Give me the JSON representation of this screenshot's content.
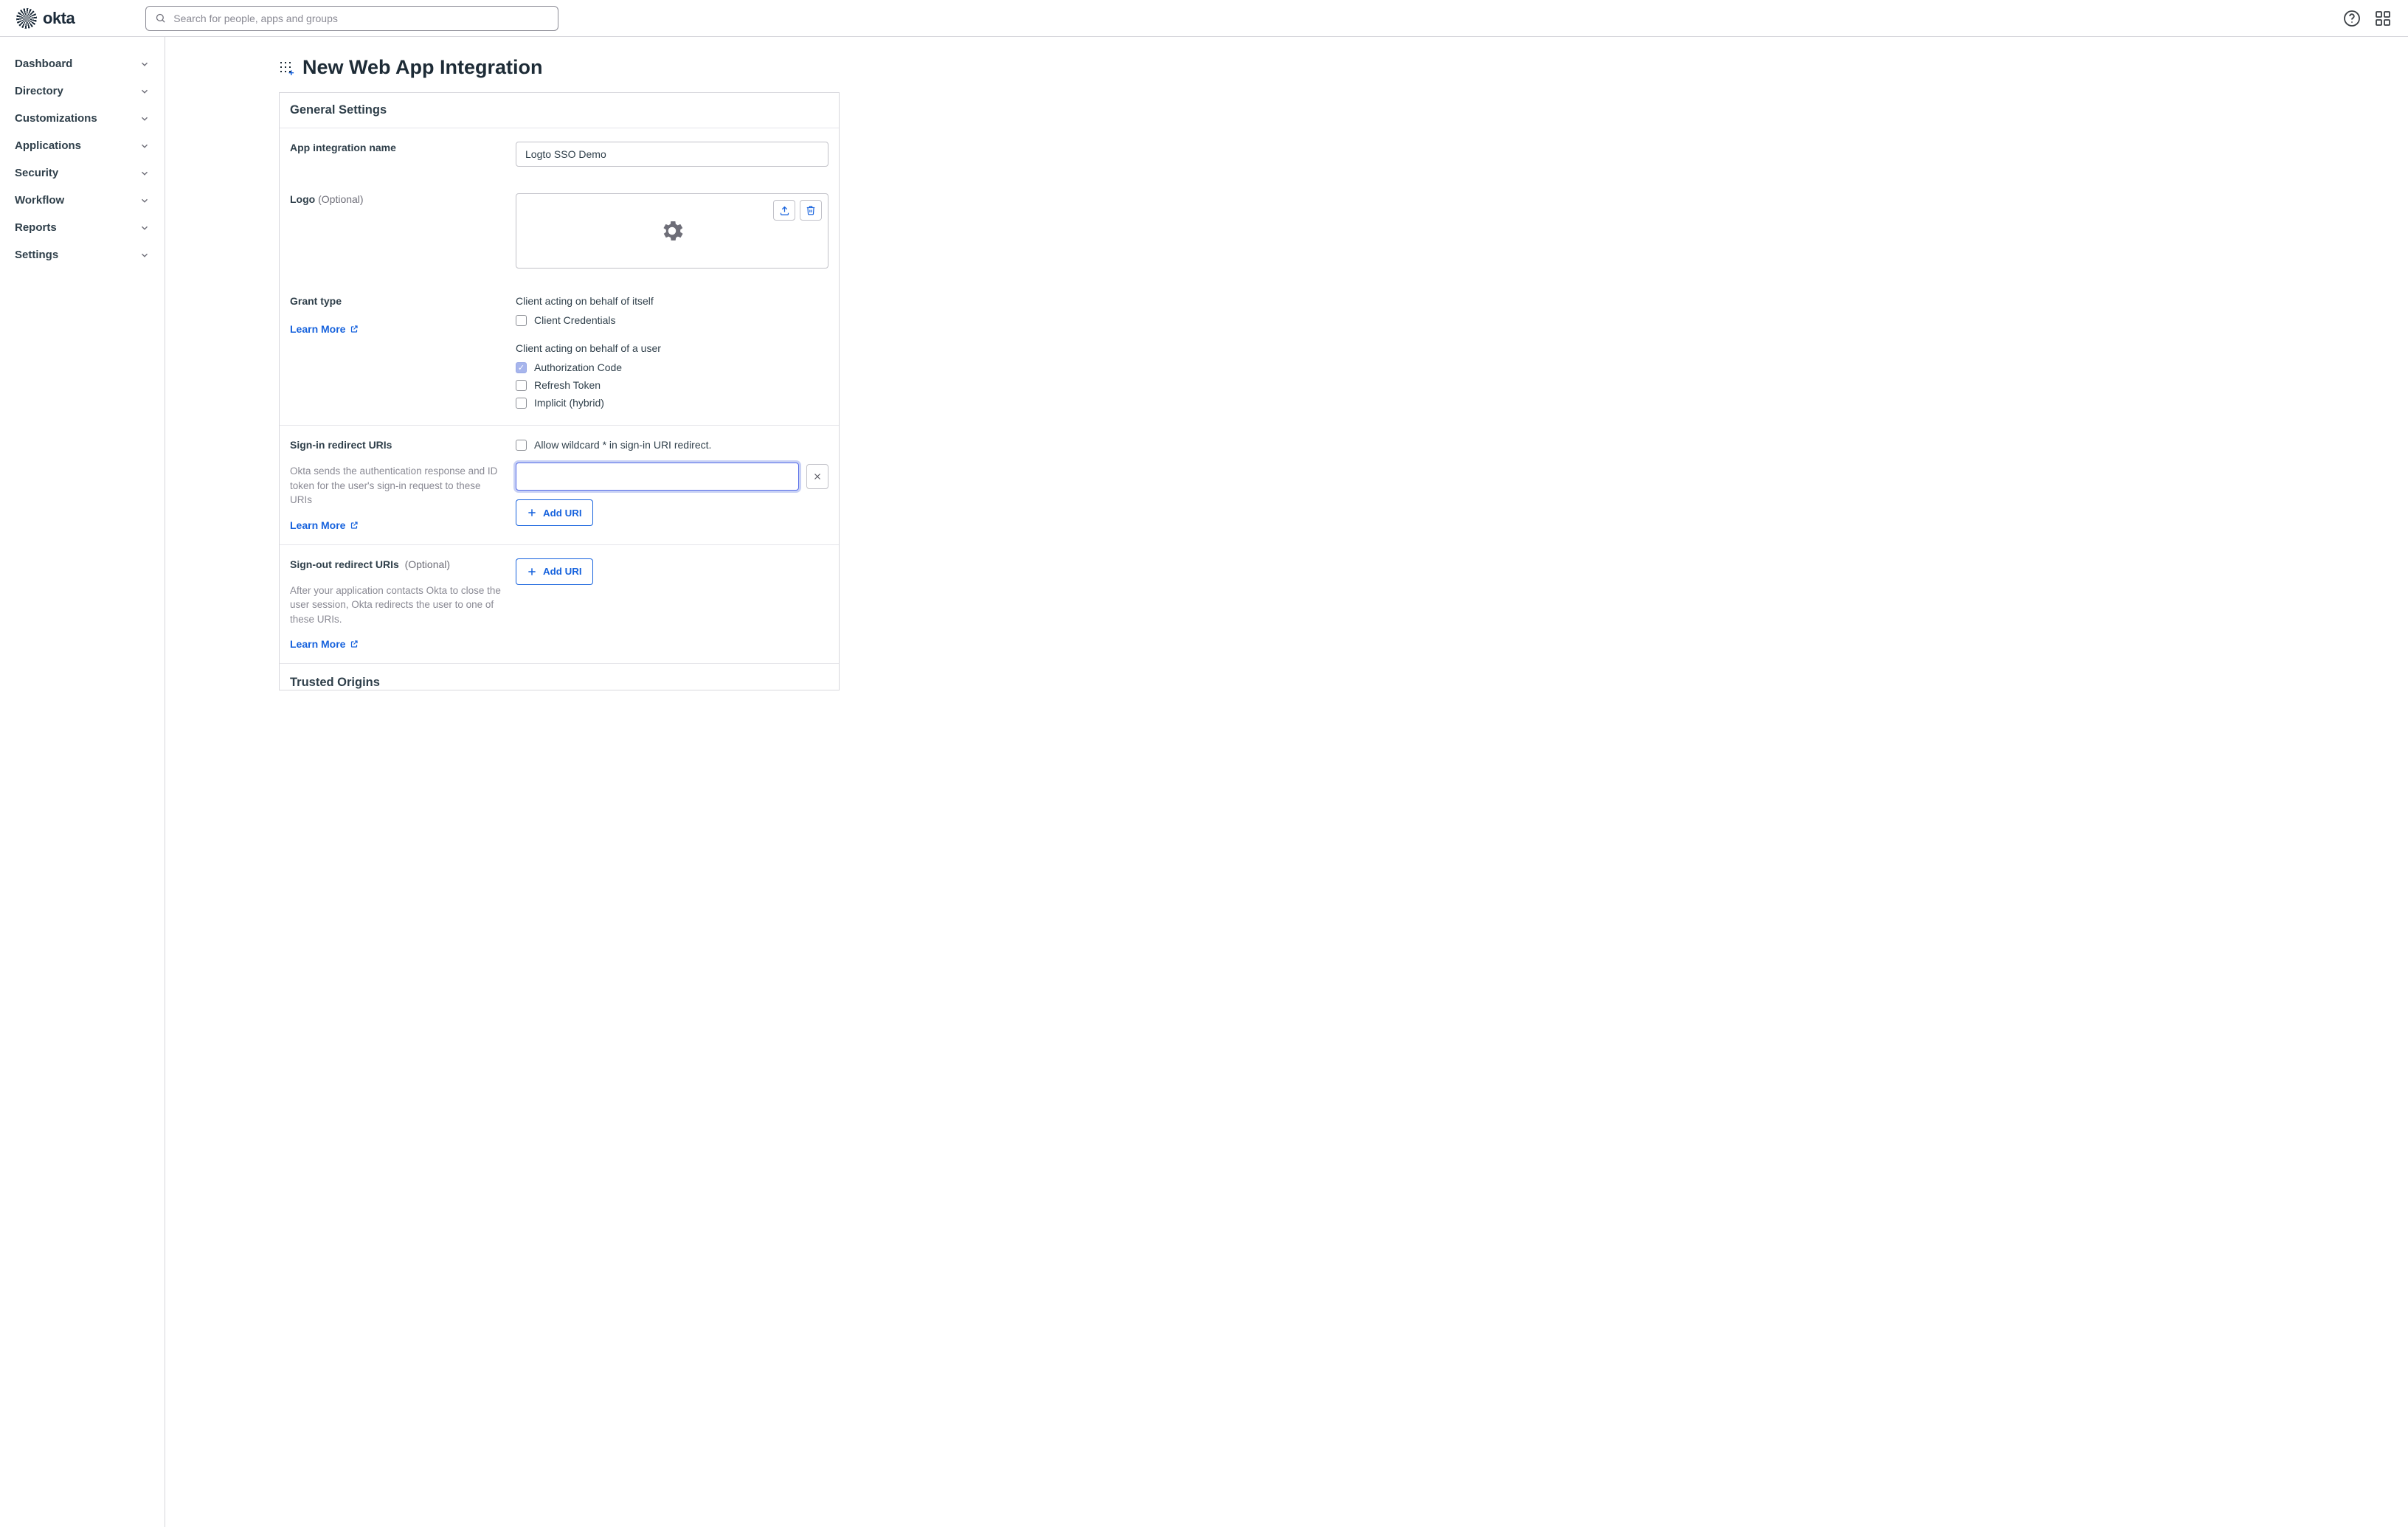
{
  "brand": {
    "name": "okta"
  },
  "search": {
    "placeholder": "Search for people, apps and groups"
  },
  "sidebar": {
    "items": [
      {
        "label": "Dashboard"
      },
      {
        "label": "Directory"
      },
      {
        "label": "Customizations"
      },
      {
        "label": "Applications"
      },
      {
        "label": "Security"
      },
      {
        "label": "Workflow"
      },
      {
        "label": "Reports"
      },
      {
        "label": "Settings"
      }
    ]
  },
  "page": {
    "title": "New Web App Integration"
  },
  "card": {
    "title": "General Settings"
  },
  "fields": {
    "app_name": {
      "label": "App integration name",
      "value": "Logto SSO Demo"
    },
    "logo": {
      "label": "Logo",
      "optional": "(Optional)"
    },
    "grant": {
      "label": "Grant type",
      "learn_more": "Learn More",
      "group_self": "Client acting on behalf of itself",
      "group_user": "Client acting on behalf of a user",
      "options": {
        "client_credentials": "Client Credentials",
        "authorization_code": "Authorization Code",
        "refresh_token": "Refresh Token",
        "implicit_hybrid": "Implicit (hybrid)"
      }
    },
    "signin": {
      "label": "Sign-in redirect URIs",
      "allow_wildcard": "Allow wildcard * in sign-in URI redirect.",
      "help": "Okta sends the authentication response and ID token for the user's sign-in request to these URIs",
      "learn_more": "Learn More",
      "add_uri": "Add URI"
    },
    "signout": {
      "label": "Sign-out redirect URIs",
      "optional": "(Optional)",
      "help": "After your application contacts Okta to close the user session, Okta redirects the user to one of these URIs.",
      "learn_more": "Learn More",
      "add_uri": "Add URI"
    },
    "trusted": {
      "title": "Trusted Origins"
    }
  }
}
